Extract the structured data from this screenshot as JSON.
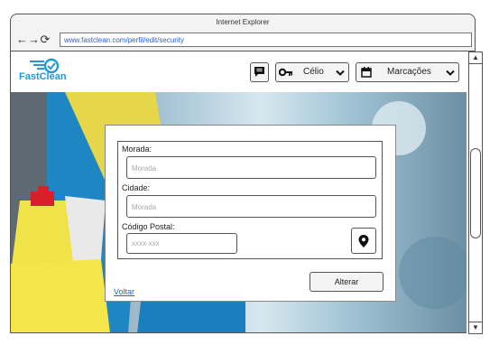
{
  "browser": {
    "title": "Internet Explorer",
    "back_glyph": "←",
    "forward_glyph": "→",
    "reload_glyph": "⟳",
    "url": "www.fastclean.com/perfil/edit/security"
  },
  "header": {
    "logo_text": "FastClean",
    "user_name": "Célio",
    "bookings_label": "Marcações"
  },
  "form": {
    "address_label": "Morada:",
    "address_placeholder": "Morada",
    "city_label": "Cidade:",
    "city_placeholder": "Morada",
    "postal_label": "Código Postal:",
    "postal_placeholder": "xxxx-xxx",
    "submit_label": "Alterar",
    "back_label": "Voltar"
  },
  "colors": {
    "brand": "#1e9bd7",
    "link": "#2b5fd9"
  },
  "icons": [
    "chat-icon",
    "key-icon",
    "chevron-down-icon",
    "calendar-icon",
    "map-pin-icon"
  ]
}
